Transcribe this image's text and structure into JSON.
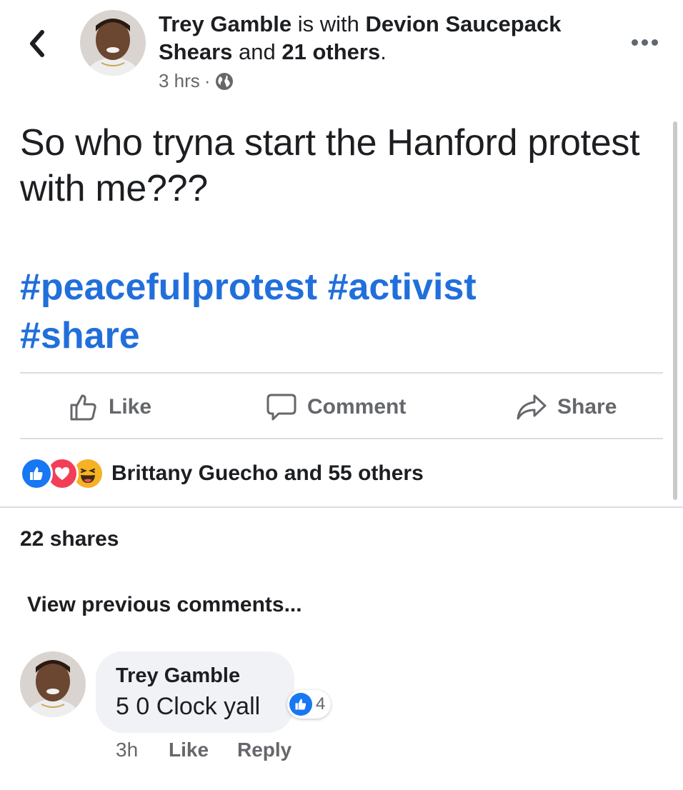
{
  "header": {
    "author": "Trey Gamble",
    "with_text": "is with",
    "tagged": "Devion Saucepack Shears",
    "and_text": "and",
    "others": "21 others",
    "period": ".",
    "time": "3 hrs",
    "separator": "·",
    "audience_icon": "globe-icon",
    "back_icon": "chevron-left-icon",
    "more_icon": "more-dots-icon"
  },
  "post": {
    "text": "So who tryna start the Hanford protest with me???",
    "hashtags": [
      "#peacefulprotest",
      "#activist",
      "#share"
    ]
  },
  "actions": {
    "like": "Like",
    "comment": "Comment",
    "share": "Share"
  },
  "reactions": {
    "icons": [
      "like-reaction-icon",
      "love-reaction-icon",
      "haha-reaction-icon"
    ],
    "summary": "Brittany Guecho and 55 others"
  },
  "shares": "22 shares",
  "comments": {
    "view_previous": "View previous comments...",
    "items": [
      {
        "author": "Trey Gamble",
        "text": "5 0 Clock yall",
        "like_count": "4",
        "time": "3h",
        "like_label": "Like",
        "reply_label": "Reply"
      }
    ]
  },
  "colors": {
    "hashtag": "#216fdb",
    "like_blue": "#1877f2",
    "love_red": "#f33e58",
    "haha_yellow": "#f7b125",
    "muted": "#65676b",
    "bubble": "#f0f2f5"
  }
}
